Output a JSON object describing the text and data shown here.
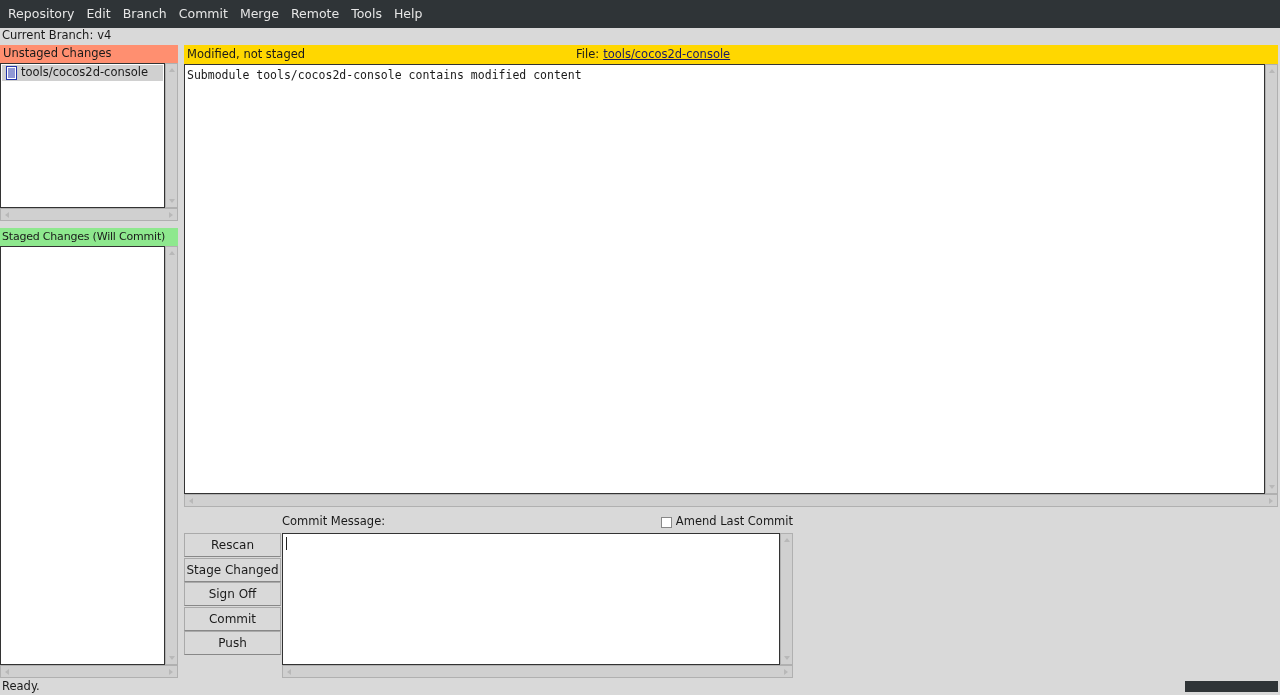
{
  "menu": [
    "Repository",
    "Edit",
    "Branch",
    "Commit",
    "Merge",
    "Remote",
    "Tools",
    "Help"
  ],
  "current_branch": {
    "label": "Current Branch:",
    "value": "v4"
  },
  "unstaged": {
    "title": "Unstaged Changes",
    "files": [
      {
        "name": "tools/cocos2d-console",
        "selected": true
      }
    ]
  },
  "staged": {
    "title": "Staged Changes (Will Commit)"
  },
  "diff": {
    "status": "Modified, not staged",
    "file_label": "File:",
    "file": "tools/cocos2d-console",
    "lines": [
      "Submodule tools/cocos2d-console contains modified content"
    ]
  },
  "commit": {
    "label": "Commit Message:",
    "amend": {
      "label": "Amend Last Commit",
      "checked": false
    },
    "buttons": [
      "Rescan",
      "Stage Changed",
      "Sign Off",
      "Commit",
      "Push"
    ]
  },
  "status_bar": "Ready."
}
